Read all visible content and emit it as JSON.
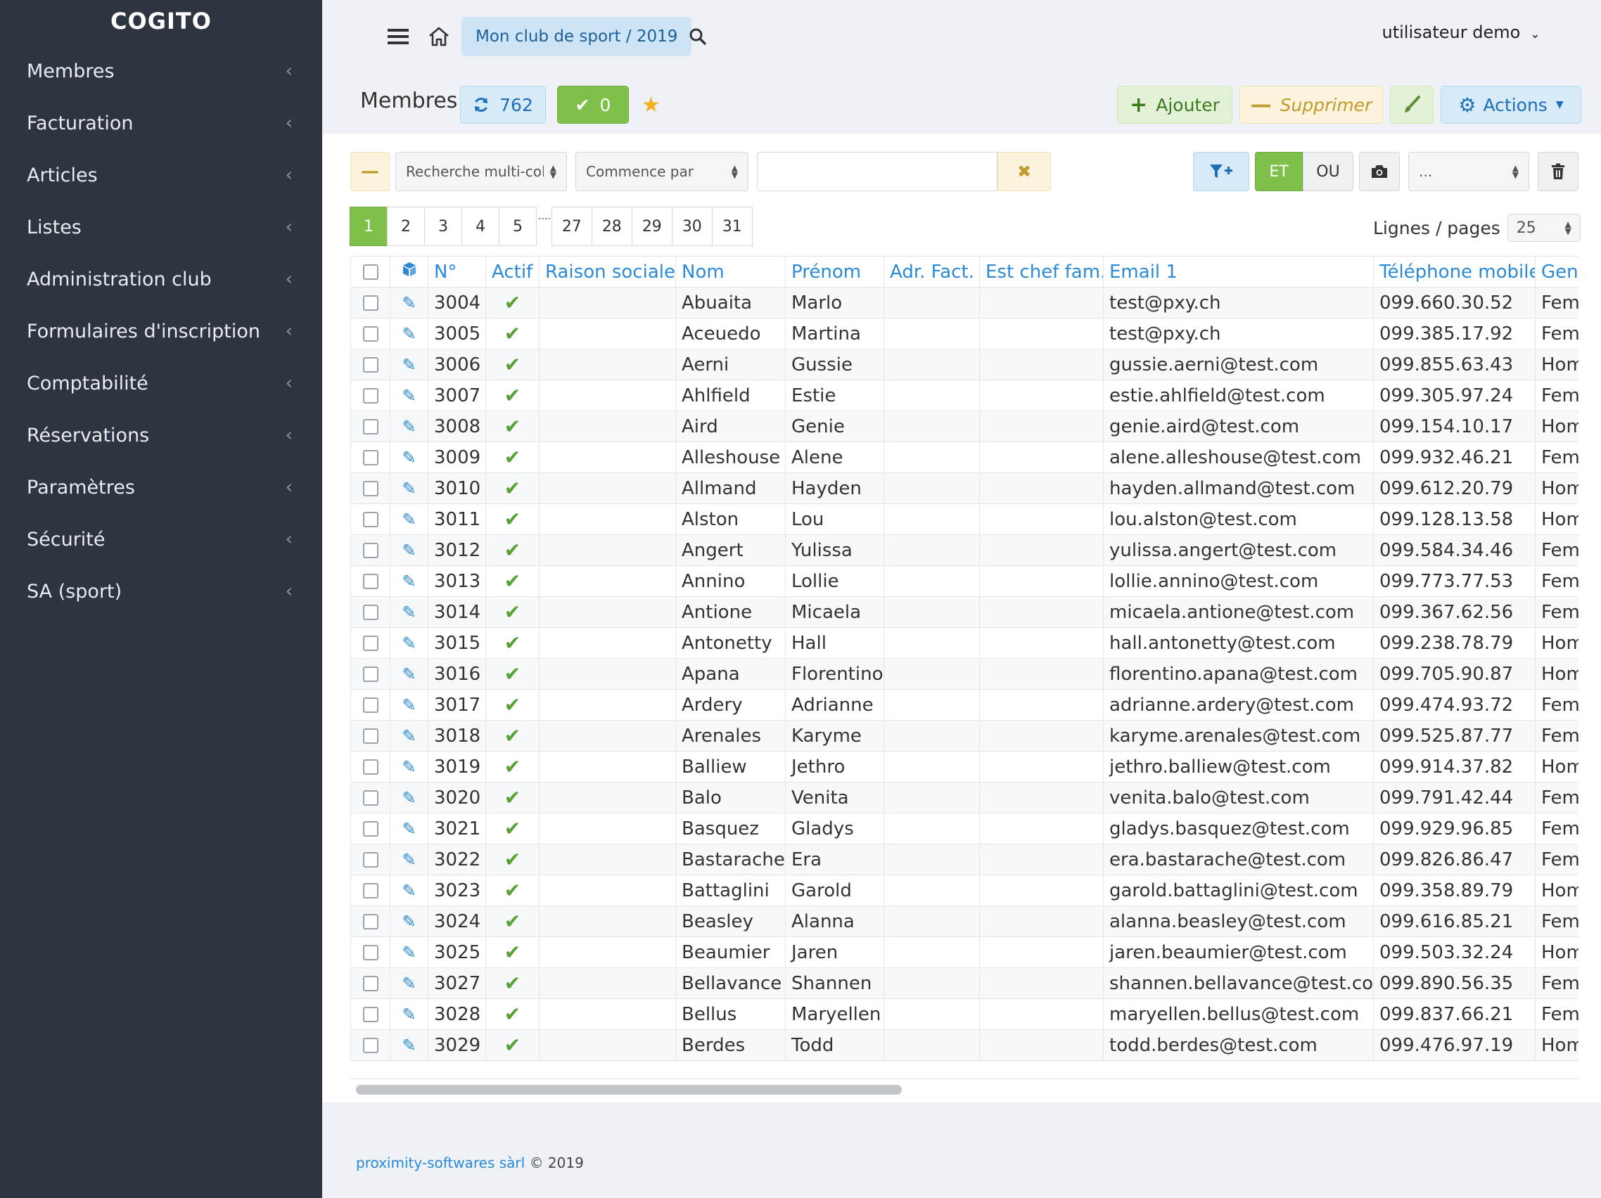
{
  "sidebar": {
    "brand": "COGITO",
    "items": [
      {
        "label": "Membres"
      },
      {
        "label": "Facturation"
      },
      {
        "label": "Articles"
      },
      {
        "label": "Listes"
      },
      {
        "label": "Administration club"
      },
      {
        "label": "Formulaires d'inscription"
      },
      {
        "label": "Comptabilité"
      },
      {
        "label": "Réservations"
      },
      {
        "label": "Paramètres"
      },
      {
        "label": "Sécurité"
      },
      {
        "label": "SA (sport)"
      }
    ]
  },
  "topbar": {
    "club": "Mon club de sport / 2019",
    "user": "utilisateur demo"
  },
  "header": {
    "title": "Membres",
    "count": "762",
    "checked": "0",
    "add_label": "Ajouter",
    "delete_label": "Supprimer",
    "actions_label": "Actions"
  },
  "filter": {
    "column_select": "Recherche multi-colc",
    "mode_select": "Commence par",
    "search_value": "",
    "and_label": "ET",
    "or_label": "OU",
    "view_select": "..."
  },
  "pagination": {
    "pages_start": [
      "1",
      "2",
      "3",
      "4",
      "5"
    ],
    "ellipsis": "....",
    "pages_end": [
      "27",
      "28",
      "29",
      "30",
      "31"
    ],
    "active": "1",
    "rows_label": "Lignes / pages",
    "rows_value": "25"
  },
  "table": {
    "columns": [
      "N°",
      "Actif",
      "Raison sociale",
      "Nom",
      "Prénom",
      "Adr. Fact.",
      "Est chef fam.",
      "Email 1",
      "Téléphone mobile",
      "Genre"
    ],
    "rows": [
      [
        "3004",
        "",
        "Abuaita",
        "Marlo",
        "test@pxy.ch",
        "099.660.30.52",
        "Femme"
      ],
      [
        "3005",
        "",
        "Aceuedo",
        "Martina",
        "test@pxy.ch",
        "099.385.17.92",
        "Femme"
      ],
      [
        "3006",
        "",
        "Aerni",
        "Gussie",
        "gussie.aerni@test.com",
        "099.855.63.43",
        "Homme"
      ],
      [
        "3007",
        "",
        "Ahlfield",
        "Estie",
        "estie.ahlfield@test.com",
        "099.305.97.24",
        "Femme"
      ],
      [
        "3008",
        "",
        "Aird",
        "Genie",
        "genie.aird@test.com",
        "099.154.10.17",
        "Homme"
      ],
      [
        "3009",
        "",
        "Alleshouse",
        "Alene",
        "alene.alleshouse@test.com",
        "099.932.46.21",
        "Femme"
      ],
      [
        "3010",
        "",
        "Allmand",
        "Hayden",
        "hayden.allmand@test.com",
        "099.612.20.79",
        "Homme"
      ],
      [
        "3011",
        "",
        "Alston",
        "Lou",
        "lou.alston@test.com",
        "099.128.13.58",
        "Homme"
      ],
      [
        "3012",
        "",
        "Angert",
        "Yulissa",
        "yulissa.angert@test.com",
        "099.584.34.46",
        "Femme"
      ],
      [
        "3013",
        "",
        "Annino",
        "Lollie",
        "lollie.annino@test.com",
        "099.773.77.53",
        "Femme"
      ],
      [
        "3014",
        "",
        "Antione",
        "Micaela",
        "micaela.antione@test.com",
        "099.367.62.56",
        "Femme"
      ],
      [
        "3015",
        "",
        "Antonetty",
        "Hall",
        "hall.antonetty@test.com",
        "099.238.78.79",
        "Homme"
      ],
      [
        "3016",
        "",
        "Apana",
        "Florentino",
        "florentino.apana@test.com",
        "099.705.90.87",
        "Homme"
      ],
      [
        "3017",
        "",
        "Ardery",
        "Adrianne",
        "adrianne.ardery@test.com",
        "099.474.93.72",
        "Femme"
      ],
      [
        "3018",
        "",
        "Arenales",
        "Karyme",
        "karyme.arenales@test.com",
        "099.525.87.77",
        "Femme"
      ],
      [
        "3019",
        "",
        "Balliew",
        "Jethro",
        "jethro.balliew@test.com",
        "099.914.37.82",
        "Homme"
      ],
      [
        "3020",
        "",
        "Balo",
        "Venita",
        "venita.balo@test.com",
        "099.791.42.44",
        "Femme"
      ],
      [
        "3021",
        "",
        "Basquez",
        "Gladys",
        "gladys.basquez@test.com",
        "099.929.96.85",
        "Femme"
      ],
      [
        "3022",
        "",
        "Bastarache",
        "Era",
        "era.bastarache@test.com",
        "099.826.86.47",
        "Femme"
      ],
      [
        "3023",
        "",
        "Battaglini",
        "Garold",
        "garold.battaglini@test.com",
        "099.358.89.79",
        "Homme"
      ],
      [
        "3024",
        "",
        "Beasley",
        "Alanna",
        "alanna.beasley@test.com",
        "099.616.85.21",
        "Femme"
      ],
      [
        "3025",
        "",
        "Beaumier",
        "Jaren",
        "jaren.beaumier@test.com",
        "099.503.32.24",
        "Homme"
      ],
      [
        "3027",
        "",
        "Bellavance",
        "Shannen",
        "shannen.bellavance@test.com",
        "099.890.56.35",
        "Femme"
      ],
      [
        "3028",
        "",
        "Bellus",
        "Maryellen",
        "maryellen.bellus@test.com",
        "099.837.66.21",
        "Femme"
      ],
      [
        "3029",
        "",
        "Berdes",
        "Todd",
        "todd.berdes@test.com",
        "099.476.97.19",
        "Homme"
      ]
    ]
  },
  "footer": {
    "company": "proximity-softwares sàrl",
    "copyright": "© 2019"
  },
  "colors": {
    "sidebar_bg": "#2e3540",
    "accent_blue": "#2a8ad8",
    "success_green": "#7fc04b",
    "warning_gold": "#c29a2d"
  }
}
